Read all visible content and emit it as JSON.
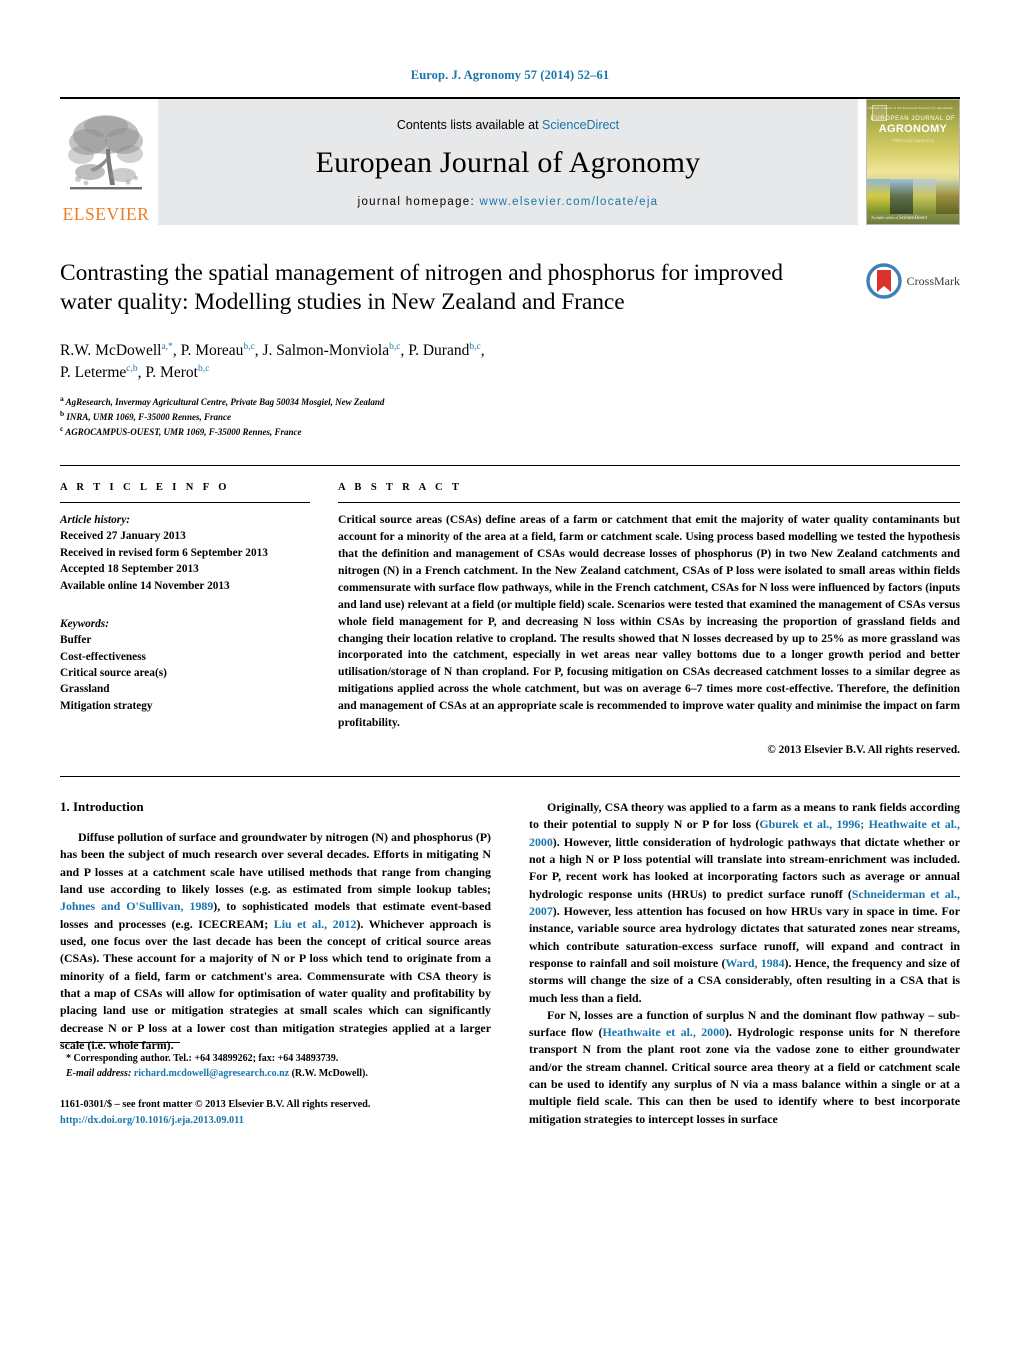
{
  "running_head": "Europ. J. Agronomy 57 (2014) 52–61",
  "masthead": {
    "contents_prefix": "Contents lists available at ",
    "sciencedirect": "ScienceDirect",
    "journal_title": "European Journal of Agronomy",
    "homepage_label": "journal homepage: ",
    "homepage_url": "www.elsevier.com/locate/eja",
    "publisher_wordmark": "ELSEVIER",
    "cover": {
      "line1": "EUROPEAN JOURNAL OF",
      "line2": "AGRONOMY",
      "line3": "Field Crop Agronomy",
      "tagline": "Official Journal of the European Society for Agronomy",
      "footer": "Available online at",
      "footer_brand": "ScienceDirect"
    }
  },
  "article": {
    "title": "Contrasting the spatial management of nitrogen and phosphorus for improved water quality: Modelling studies in New Zealand and France",
    "crossmark_label": "CrossMark",
    "authors_line1": "R.W. McDowell",
    "authors_line1_sup": "a,*",
    "authors": [
      {
        "name": "R.W. McDowell",
        "sup": "a,*"
      },
      {
        "name": "P. Moreau",
        "sup": "b,c"
      },
      {
        "name": "J. Salmon-Monviola",
        "sup": "b,c"
      },
      {
        "name": "P. Durand",
        "sup": "b,c"
      },
      {
        "name": "P. Leterme",
        "sup": "c,b"
      },
      {
        "name": "P. Merot",
        "sup": "b,c"
      }
    ],
    "affiliations": [
      {
        "marker": "a",
        "text": "AgResearch, Invermay Agricultural Centre, Private Bag 50034 Mosgiel, New Zealand"
      },
      {
        "marker": "b",
        "text": "INRA, UMR 1069, F-35000 Rennes, France"
      },
      {
        "marker": "c",
        "text": "AGROCAMPUS-OUEST, UMR 1069, F-35000 Rennes, France"
      }
    ]
  },
  "article_info": {
    "heading": "A R T I C L E   I N F O",
    "history_label": "Article history:",
    "history": [
      "Received 27 January 2013",
      "Received in revised form 6 September 2013",
      "Accepted 18 September 2013",
      "Available online 14 November 2013"
    ],
    "keywords_label": "Keywords:",
    "keywords": [
      "Buffer",
      "Cost-effectiveness",
      "Critical source area(s)",
      "Grassland",
      "Mitigation strategy"
    ]
  },
  "abstract": {
    "heading": "A B S T R A C T",
    "text": "Critical source areas (CSAs) define areas of a farm or catchment that emit the majority of water quality contaminants but account for a minority of the area at a field, farm or catchment scale. Using process based modelling we tested the hypothesis that the definition and management of CSAs would decrease losses of phosphorus (P) in two New Zealand catchments and nitrogen (N) in a French catchment. In the New Zealand catchment, CSAs of P loss were isolated to small areas within fields commensurate with surface flow pathways, while in the French catchment, CSAs for N loss were influenced by factors (inputs and land use) relevant at a field (or multiple field) scale. Scenarios were tested that examined the management of CSAs versus whole field management for P, and decreasing N loss within CSAs by increasing the proportion of grassland fields and changing their location relative to cropland. The results showed that N losses decreased by up to 25% as more grassland was incorporated into the catchment, especially in wet areas near valley bottoms due to a longer growth period and better utilisation/storage of N than cropland. For P, focusing mitigation on CSAs decreased catchment losses to a similar degree as mitigations applied across the whole catchment, but was on average 6–7 times more cost-effective. Therefore, the definition and management of CSAs at an appropriate scale is recommended to improve water quality and minimise the impact on farm profitability.",
    "copyright": "© 2013 Elsevier B.V. All rights reserved."
  },
  "body": {
    "section_number_title": "1.  Introduction",
    "left_para_1_a": "Diffuse pollution of surface and groundwater by nitrogen (N) and phosphorus (P) has been the subject of much research over several decades. Efforts in mitigating N and P losses at a catchment scale have utilised methods that range from changing land use according to likely losses (e.g. as estimated from simple lookup tables; ",
    "left_cite_1": "Johnes and O'Sullivan, 1989",
    "left_para_1_b": "), to sophisticated models that estimate event-based losses and processes (e.g. ICECREAM; ",
    "left_cite_2": "Liu et al., 2012",
    "left_para_1_c": "). Whichever approach is used, one focus over the last decade has been the concept of critical source areas (CSAs). These account for a majority of N or P loss which tend to originate from a minority of a field, farm or catchment's area. Commensurate with CSA theory is that a map of CSAs will allow for optimisation of water quality and profitability by placing land use or mitigation strategies at small scales which can significantly decrease N or P loss at a lower cost than mitigation strategies applied at a larger scale (i.e. whole farm).",
    "right_para_1_a": "Originally, CSA theory was applied to a farm as a means to rank fields according to their potential to supply N or P for loss (",
    "right_cite_1": "Gburek et al., 1996; Heathwaite et al., 2000",
    "right_para_1_b": "). However, little consideration of hydrologic pathways that dictate whether or not a high N or P loss potential will translate into stream-enrichment was included. For P, recent work has looked at incorporating factors such as average or annual hydrologic response units (HRUs) to predict surface runoff (",
    "right_cite_2": "Schneiderman et al., 2007",
    "right_para_1_c": "). However, less attention has focused on how HRUs vary in space in time. For instance, variable source area hydrology dictates that saturated zones near streams, which contribute saturation-excess surface runoff, will expand and contract in response to rainfall and soil moisture (",
    "right_cite_3": "Ward, 1984",
    "right_para_1_d": "). Hence, the frequency and size of storms will change the size of a CSA considerably, often resulting in a CSA that is much less than a field.",
    "right_para_2_a": "For N, losses are a function of surplus N and the dominant flow pathway – sub-surface flow (",
    "right_cite_4": "Heathwaite et al., 2000",
    "right_para_2_b": "). Hydrologic response units for N therefore transport N from the plant root zone via the vadose zone to either groundwater and/or the stream channel. Critical source area theory at a field or catchment scale can be used to identify any surplus of N via a mass balance within a single or at a multiple field scale. This can then be used to identify where to best incorporate mitigation strategies to intercept losses in surface"
  },
  "footnotes": {
    "corresponding_marker": "*",
    "corresponding_text": "Corresponding author. Tel.: +64 34899262; fax: +64 34893739.",
    "email_label": "E-mail address:",
    "email": "richard.mcdowell@agresearch.co.nz",
    "email_owner": "(R.W. McDowell).",
    "issn_line": "1161-0301/$ – see front matter © 2013 Elsevier B.V. All rights reserved.",
    "doi": "http://dx.doi.org/10.1016/j.eja.2013.09.011"
  },
  "colors": {
    "link_blue": "#1a75ab",
    "elsevier_orange": "#ef7d22",
    "band_gray": "#e7e8ea",
    "crossmark_blue": "#3d7fb8",
    "crossmark_red": "#d9342b"
  }
}
